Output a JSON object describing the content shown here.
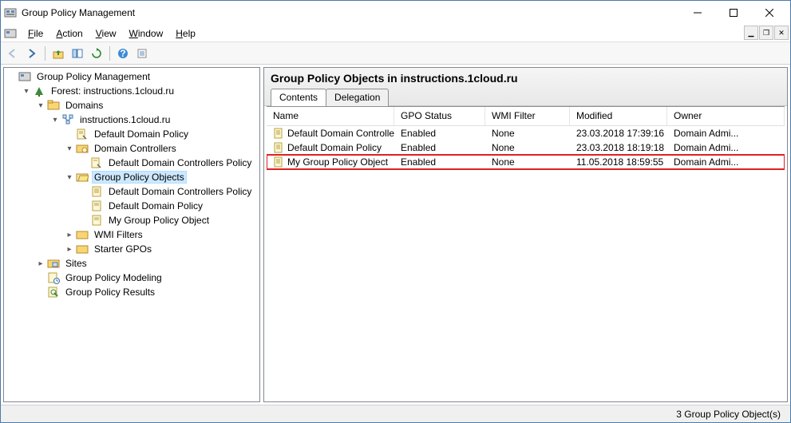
{
  "window": {
    "title": "Group Policy Management"
  },
  "menu": {
    "file": "File",
    "action": "Action",
    "view": "View",
    "window": "Window",
    "help": "Help"
  },
  "tree": {
    "root": "Group Policy Management",
    "forest": "Forest: instructions.1cloud.ru",
    "domains": "Domains",
    "domain": "instructions.1cloud.ru",
    "ddp": "Default Domain Policy",
    "dc": "Domain Controllers",
    "ddcp": "Default Domain Controllers Policy",
    "gpo": "Group Policy Objects",
    "gpo_ddcp": "Default Domain Controllers Policy",
    "gpo_ddp": "Default Domain Policy",
    "gpo_my": "My Group Policy Object",
    "wmi": "WMI Filters",
    "starter": "Starter GPOs",
    "sites": "Sites",
    "modeling": "Group Policy Modeling",
    "results": "Group Policy Results"
  },
  "detail": {
    "heading": "Group Policy Objects in instructions.1cloud.ru",
    "tabs": {
      "contents": "Contents",
      "delegation": "Delegation"
    },
    "columns": {
      "name": "Name",
      "status": "GPO Status",
      "wmi": "WMI Filter",
      "modified": "Modified",
      "owner": "Owner"
    },
    "rows": [
      {
        "name": "Default Domain Controller...",
        "status": "Enabled",
        "wmi": "None",
        "modified": "23.03.2018 17:39:16",
        "owner": "Domain Admi...",
        "highlight": false
      },
      {
        "name": "Default Domain Policy",
        "status": "Enabled",
        "wmi": "None",
        "modified": "23.03.2018 18:19:18",
        "owner": "Domain Admi...",
        "highlight": false
      },
      {
        "name": "My Group Policy Object",
        "status": "Enabled",
        "wmi": "None",
        "modified": "11.05.2018 18:59:55",
        "owner": "Domain Admi...",
        "highlight": true
      }
    ]
  },
  "status": {
    "text": "3 Group Policy Object(s)"
  }
}
